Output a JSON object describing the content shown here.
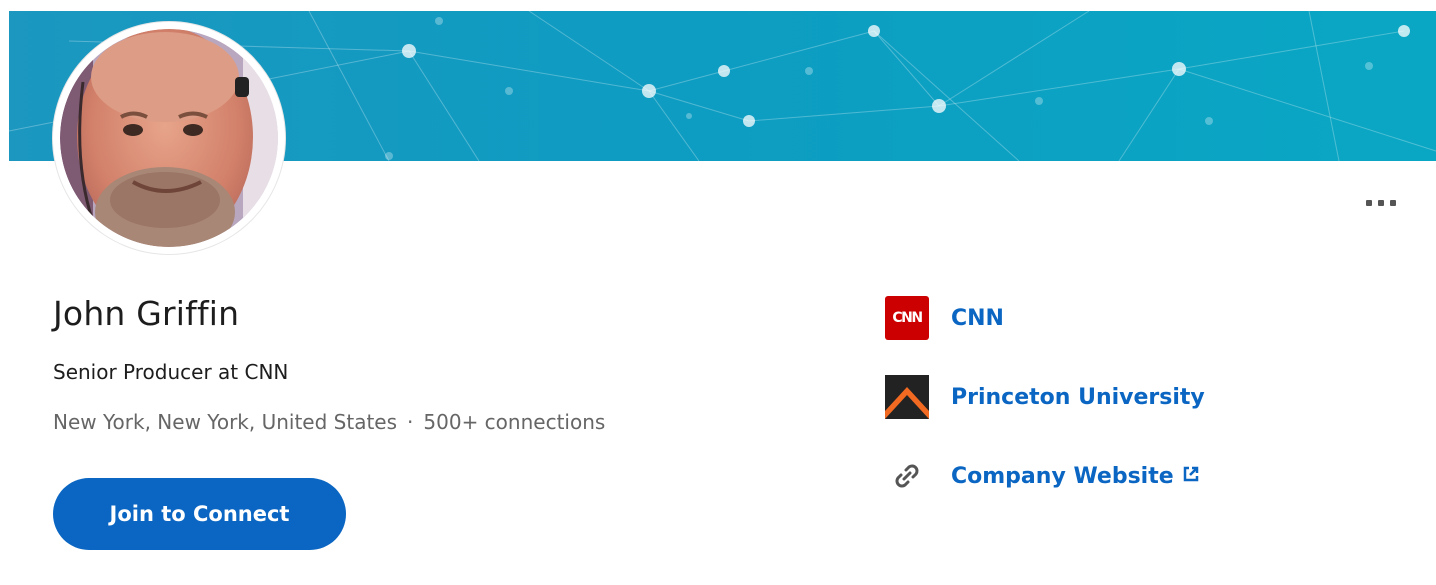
{
  "profile": {
    "name": "John Griffin",
    "headline": "Senior Producer at CNN",
    "location": "New York, New York, United States",
    "separator": "·",
    "connections": "500+ connections"
  },
  "actions": {
    "join_label": "Join to Connect",
    "more_icon": "more-horizontal-icon"
  },
  "links": {
    "company": {
      "label": "CNN",
      "logo_text": "CNN",
      "logo_color": "#cc0000"
    },
    "education": {
      "label": "Princeton University",
      "logo_colors": [
        "#222222",
        "#f26a21"
      ]
    },
    "website": {
      "label": "Company Website",
      "icon": "link-icon",
      "external_icon": "external-link-icon"
    }
  },
  "colors": {
    "accent": "#0a66c2",
    "banner_start": "#1b97c0",
    "banner_end": "#0aa7c4",
    "text_primary": "#1d1d1d",
    "text_secondary": "#666666"
  }
}
